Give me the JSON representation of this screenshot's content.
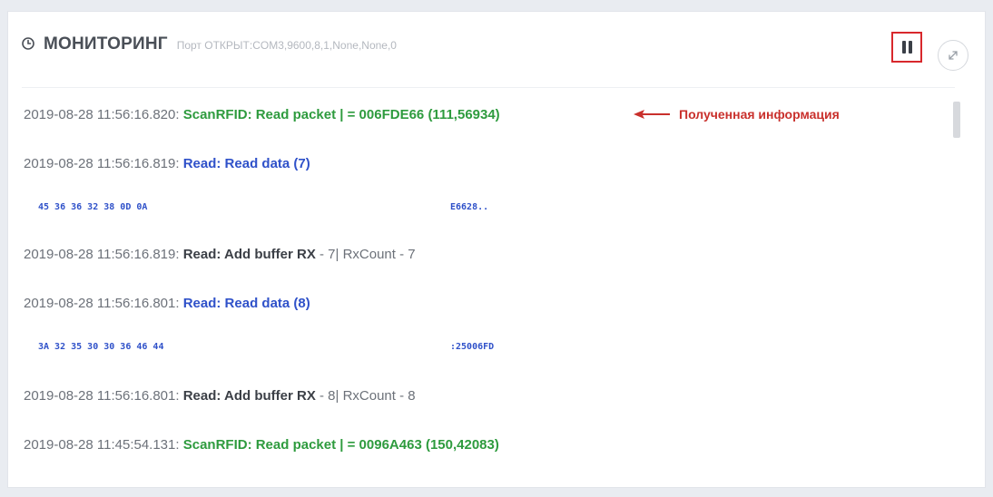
{
  "header": {
    "title": "МОНИТОРИНГ",
    "port_status": "Порт ОТКРЫТ:COM3,9600,8,1,None,None,0",
    "icons": {
      "title_icon": "clock-icon",
      "pause": "pause-icon",
      "expand": "expand-icon"
    }
  },
  "log": [
    {
      "ts": "2019-08-28 11:56:16.820:",
      "msg": "ScanRFID: Read packet | = 006FDE66 (111,56934)",
      "tail": ""
    },
    {
      "ts": "2019-08-28 11:56:16.819:",
      "msg": "Read: Read data (7)",
      "tail": ""
    },
    {
      "hex": "45 36 36 32 38 0D 0A",
      "ascii": "E6628.."
    },
    {
      "ts": "2019-08-28 11:56:16.819:",
      "msg": "Read: Add buffer RX",
      "tail": "- 7| RxCount - 7"
    },
    {
      "ts": "2019-08-28 11:56:16.801:",
      "msg": "Read: Read data (8)",
      "tail": ""
    },
    {
      "hex": "3A 32 35 30 30 36 46 44",
      "ascii": ":25006FD"
    },
    {
      "ts": "2019-08-28 11:56:16.801:",
      "msg": "Read: Add buffer RX",
      "tail": "- 8| RxCount - 8"
    },
    {
      "ts": "2019-08-28 11:45:54.131:",
      "msg": "ScanRFID: Read packet | = 0096A463 (150,42083)",
      "tail": ""
    }
  ],
  "annotation": {
    "text": "Полученная информация",
    "color": "#c9302c"
  },
  "colors": {
    "green": "#2e9b3e",
    "blue": "#2f51c9",
    "highlight_border": "#d8282c"
  }
}
